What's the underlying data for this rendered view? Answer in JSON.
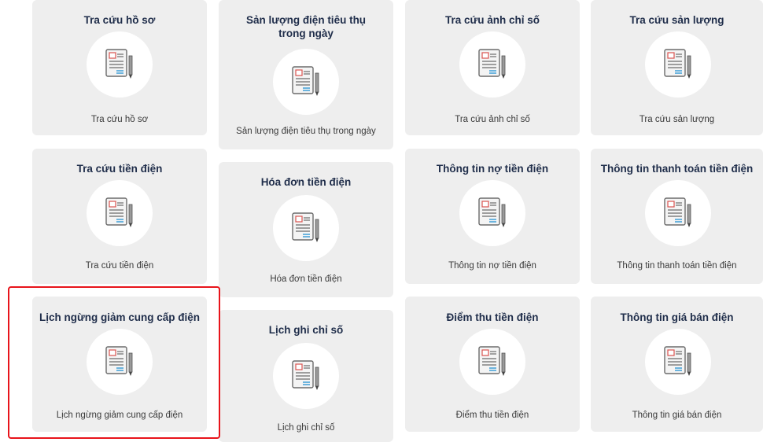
{
  "cards": [
    {
      "title": "Tra cứu hồ sơ",
      "subtitle": "Tra cứu hồ sơ",
      "icon": "document-pencil-icon"
    },
    {
      "title": "Sản lượng điện tiêu thụ trong ngày",
      "subtitle": "Sản lượng điện tiêu thụ trong ngày",
      "icon": "document-pencil-icon"
    },
    {
      "title": "Tra cứu ảnh chỉ số",
      "subtitle": "Tra cứu ảnh chỉ số",
      "icon": "document-pencil-icon"
    },
    {
      "title": "Tra cứu sản lượng",
      "subtitle": "Tra cứu sản lượng",
      "icon": "document-pencil-icon"
    },
    {
      "title": "Tra cứu tiền điện",
      "subtitle": "Tra cứu tiền điện",
      "icon": "document-pencil-icon"
    },
    {
      "title": "Hóa đơn tiền điện",
      "subtitle": "Hóa đơn tiền điện",
      "icon": "document-pencil-icon"
    },
    {
      "title": "Thông tin nợ tiền điện",
      "subtitle": "Thông tin nợ tiền điện",
      "icon": "document-pencil-icon"
    },
    {
      "title": "Thông tin thanh toán tiền điện",
      "subtitle": "Thông tin thanh toán tiền điện",
      "icon": "document-pencil-icon"
    },
    {
      "title": "Lịch ngừng giảm cung cấp điện",
      "subtitle": "Lịch ngừng giảm cung cấp điện",
      "icon": "document-pencil-icon"
    },
    {
      "title": "Lịch ghi chỉ số",
      "subtitle": "Lịch ghi chỉ số",
      "icon": "document-pencil-icon"
    },
    {
      "title": "Điểm thu tiền điện",
      "subtitle": "Điểm thu tiền điện",
      "icon": "document-pencil-icon"
    },
    {
      "title": "Thông tin giá bán điện",
      "subtitle": "Thông tin giá bán điện",
      "icon": "document-pencil-icon"
    }
  ],
  "highlight": {
    "color": "#e8141b",
    "card": "Lịch ngừng giảm cung cấp điện"
  }
}
